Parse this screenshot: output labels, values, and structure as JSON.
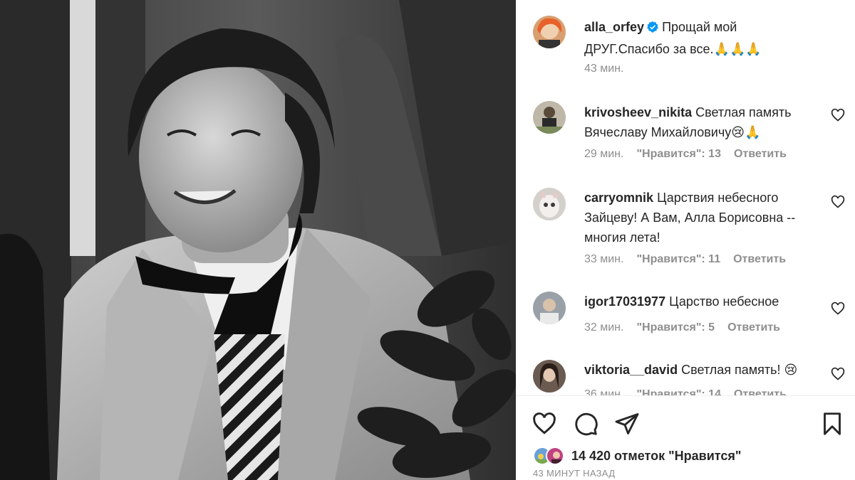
{
  "post": {
    "author": "alla_orfey",
    "caption": "Прощай мой ДРУГ.Спасибо за все.🙏🙏🙏",
    "time": "43 мин."
  },
  "comments": [
    {
      "user": "krivosheev_nikita",
      "text": "Светлая память Вячеславу Михайловичу😢🙏",
      "time": "29 мин.",
      "likes": "\"Нравится\": 13",
      "reply": "Ответить"
    },
    {
      "user": "carryomnik",
      "text": "Царствия небесного Зайцеву! А Вам, Алла Борисовна -- многия лета!",
      "time": "33 мин.",
      "likes": "\"Нравится\": 11",
      "reply": "Ответить"
    },
    {
      "user": "igor17031977",
      "text": "Царство небесное",
      "time": "32 мин.",
      "likes": "\"Нравится\": 5",
      "reply": "Ответить"
    },
    {
      "user": "viktoria__david",
      "text": "Светлая память! 😢",
      "time": "36 мин.",
      "likes": "\"Нравится\": 14",
      "reply": "Ответить"
    }
  ],
  "footer": {
    "likes_text": "14 420 отметок \"Нравится\"",
    "posted": "43 МИНУТ НАЗАД"
  },
  "icons": {
    "like": "heart-icon",
    "comment": "comment-icon",
    "share": "send-icon",
    "save": "bookmark-icon",
    "verified": "verified-badge-icon"
  },
  "colors": {
    "text": "#262626",
    "meta": "#8e8e8e",
    "verified": "#0095f6"
  }
}
